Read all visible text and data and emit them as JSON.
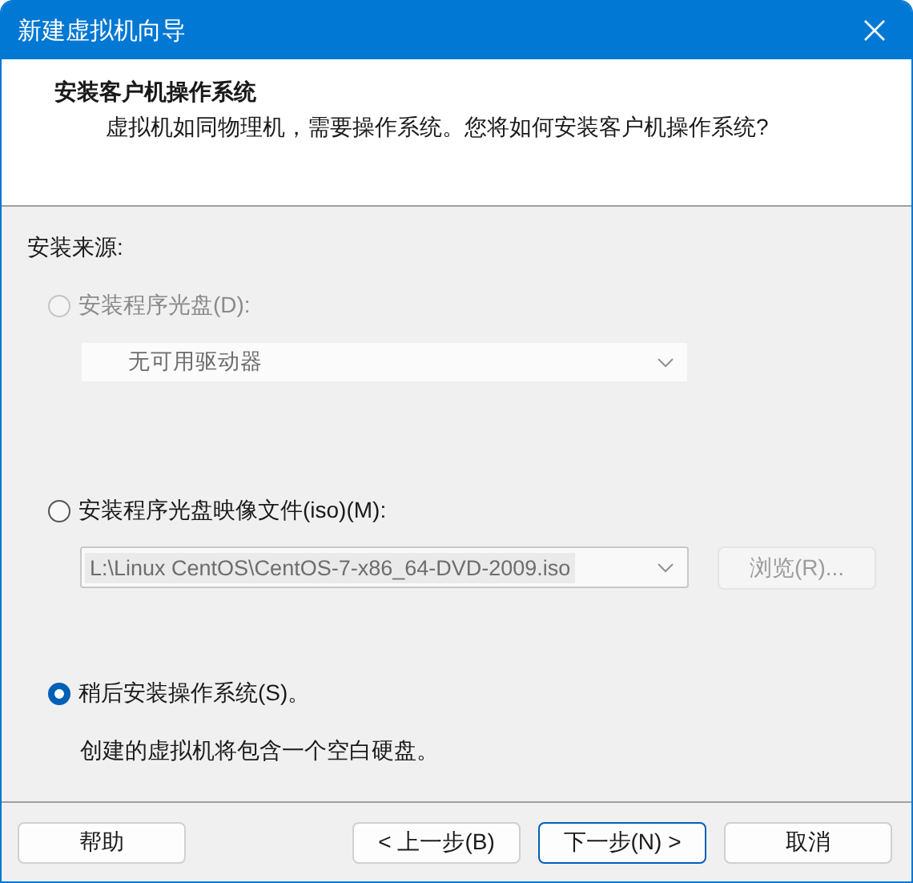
{
  "window": {
    "title": "新建虚拟机向导"
  },
  "header": {
    "title": "安装客户机操作系统",
    "subtitle": "虚拟机如同物理机，需要操作系统。您将如何安装客户机操作系统?"
  },
  "source_label": "安装来源:",
  "options": [
    {
      "kind": "disc",
      "label": "安装程序光盘(D):",
      "selected": false,
      "disabled": true,
      "drive": {
        "value": "无可用驱动器"
      }
    },
    {
      "kind": "iso",
      "label": "安装程序光盘映像文件(iso)(M):",
      "selected": false,
      "disabled": false,
      "path": {
        "value": "L:\\Linux CentOS\\CentOS-7-x86_64-DVD-2009.iso",
        "disabled": true
      },
      "browse": {
        "label": "浏览(R)...",
        "disabled": true
      }
    },
    {
      "kind": "later",
      "label": "稍后安装操作系统(S)。",
      "selected": true,
      "disabled": false,
      "description": "创建的虚拟机将包含一个空白硬盘。"
    }
  ],
  "buttons": [
    {
      "kind": "help",
      "label": "帮助",
      "default": false
    },
    {
      "kind": "back",
      "label": "< 上一步(B)",
      "default": false
    },
    {
      "kind": "next",
      "label": "下一步(N) >",
      "default": true
    },
    {
      "kind": "cancel",
      "label": "取消",
      "default": false
    }
  ]
}
